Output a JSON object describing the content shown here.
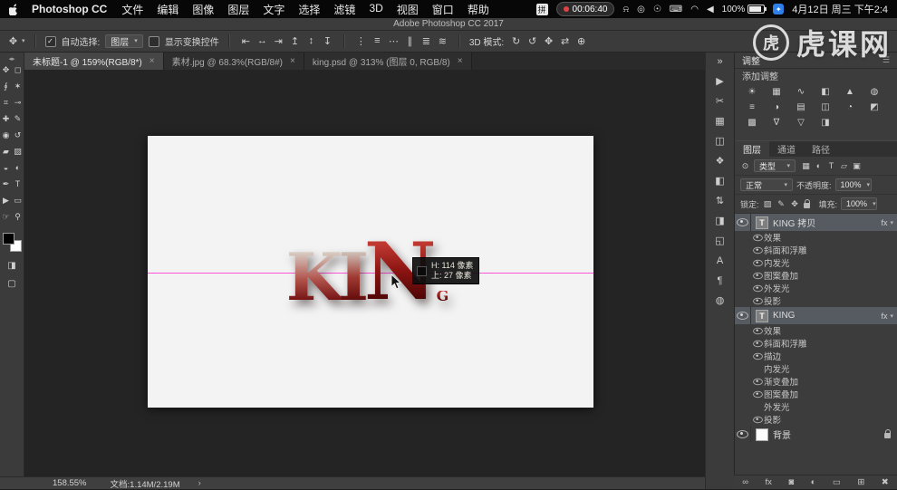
{
  "ui": {
    "caret_down": "▾",
    "check": "✓",
    "close": "×"
  },
  "menu_bar": {
    "app_name": "Photoshop CC",
    "menus": [
      "文件",
      "编辑",
      "图像",
      "图层",
      "文字",
      "选择",
      "滤镜",
      "3D",
      "视图",
      "窗口",
      "帮助"
    ],
    "input_badge": "拼",
    "timer": "00:06:40",
    "status_icons": [
      {
        "name": "bell-icon",
        "glyph": "⍾"
      },
      {
        "name": "siri-icon",
        "glyph": "◎"
      },
      {
        "name": "display-icon",
        "glyph": "☉"
      },
      {
        "name": "keyboard-icon",
        "glyph": "⌨"
      },
      {
        "name": "wifi-icon",
        "glyph": "◠"
      },
      {
        "name": "volume-icon",
        "glyph": "◀"
      }
    ],
    "battery": "100%",
    "datetime": "4月12日 周三 下午2:4"
  },
  "window_title": "Adobe Photoshop CC 2017",
  "options_bar": {
    "tool_icon": "✥",
    "auto_select_label": "自动选择:",
    "auto_select_value": "图层",
    "show_transform_label": "显示变换控件",
    "align_icons": [
      {
        "name": "align-left-edges-icon",
        "glyph": "⇤"
      },
      {
        "name": "align-horizontal-centers-icon",
        "glyph": "↔"
      },
      {
        "name": "align-right-edges-icon",
        "glyph": "⇥"
      },
      {
        "name": "align-top-edges-icon",
        "glyph": "↥"
      },
      {
        "name": "align-vertical-centers-icon",
        "glyph": "↕"
      },
      {
        "name": "align-bottom-edges-icon",
        "glyph": "↧"
      }
    ],
    "distribute_icons": [
      {
        "name": "distribute-top-icon",
        "glyph": "⋮"
      },
      {
        "name": "distribute-vertical-icon",
        "glyph": "≡"
      },
      {
        "name": "distribute-bottom-icon",
        "glyph": "⋯"
      },
      {
        "name": "distribute-left-icon",
        "glyph": "∥"
      },
      {
        "name": "distribute-horizontal-icon",
        "glyph": "≣"
      },
      {
        "name": "distribute-right-icon",
        "glyph": "≋"
      }
    ],
    "mode_3d_label": "3D 模式:",
    "mode_3d_icons": [
      {
        "name": "3d-rotate-icon",
        "glyph": "↻"
      },
      {
        "name": "3d-roll-icon",
        "glyph": "↺"
      },
      {
        "name": "3d-drag-icon",
        "glyph": "✥"
      },
      {
        "name": "3d-slide-icon",
        "glyph": "⇄"
      },
      {
        "name": "3d-scale-icon",
        "glyph": "⊕"
      }
    ]
  },
  "tabs": [
    {
      "label": "未标题-1 @ 159%(RGB/8*)",
      "active": true
    },
    {
      "label": "素材.jpg @ 68.3%(RGB/8#)",
      "active": false
    },
    {
      "label": "king.psd @ 313% (图层 0, RGB/8)",
      "active": false
    }
  ],
  "toolbar": {
    "collapse_icon": "◂▸",
    "tools": [
      {
        "name": "move-tool",
        "glyph": "✥"
      },
      {
        "name": "marquee-tool",
        "glyph": "◻"
      },
      {
        "name": "lasso-tool",
        "glyph": "∮"
      },
      {
        "name": "quick-select-tool",
        "glyph": "✶"
      },
      {
        "name": "crop-tool",
        "glyph": "⌗"
      },
      {
        "name": "eyedropper-tool",
        "glyph": "⊸"
      },
      {
        "name": "healing-brush-tool",
        "glyph": "✚"
      },
      {
        "name": "brush-tool",
        "glyph": "✎"
      },
      {
        "name": "clone-stamp-tool",
        "glyph": "◉"
      },
      {
        "name": "history-brush-tool",
        "glyph": "↺"
      },
      {
        "name": "eraser-tool",
        "glyph": "▰"
      },
      {
        "name": "gradient-tool",
        "glyph": "▨"
      },
      {
        "name": "blur-tool",
        "glyph": "◒"
      },
      {
        "name": "dodge-tool",
        "glyph": "◐"
      },
      {
        "name": "pen-tool",
        "glyph": "✒"
      },
      {
        "name": "type-tool",
        "glyph": "T"
      },
      {
        "name": "path-select-tool",
        "glyph": "▶"
      },
      {
        "name": "shape-tool",
        "glyph": "▭"
      },
      {
        "name": "hand-tool",
        "glyph": "☞"
      },
      {
        "name": "zoom-tool",
        "glyph": "⚲"
      }
    ],
    "quick_mask_icon": "◨",
    "screen_mode_icon": "▢"
  },
  "canvas": {
    "letters": [
      "K",
      "I",
      "N",
      "G"
    ],
    "tooltip": {
      "line1": "H: 114 像素",
      "line2": "上: 27 像素"
    }
  },
  "panel_strip": {
    "icons": [
      {
        "name": "collapse-panels-icon",
        "glyph": "»"
      },
      {
        "name": "libraries-panel-icon",
        "glyph": "▶"
      },
      {
        "name": "scissors-icon",
        "glyph": "✂"
      },
      {
        "name": "grid-panel-icon",
        "glyph": "▦"
      },
      {
        "name": "swatches-panel-icon",
        "glyph": "◫"
      },
      {
        "name": "styles-panel-icon",
        "glyph": "❖"
      },
      {
        "name": "adjustments-panel-icon",
        "glyph": "◧"
      },
      {
        "name": "history-panel-icon",
        "glyph": "⇅"
      },
      {
        "name": "gradients-panel-icon",
        "glyph": "◨"
      },
      {
        "name": "3d-panel-icon",
        "glyph": "◱"
      },
      {
        "name": "character-panel-icon",
        "glyph": "A"
      },
      {
        "name": "paragraph-panel-icon",
        "glyph": "¶"
      },
      {
        "name": "clone-source-panel-icon",
        "glyph": "◍"
      }
    ]
  },
  "adjustments": {
    "title": "调整",
    "menu_icon": "☰",
    "add_label": "添加调整",
    "icons": [
      {
        "name": "brightness-contrast-icon",
        "glyph": "☀"
      },
      {
        "name": "levels-icon",
        "glyph": "▦"
      },
      {
        "name": "curves-icon",
        "glyph": "∿"
      },
      {
        "name": "exposure-icon",
        "glyph": "◧"
      },
      {
        "name": "vibrance-icon",
        "glyph": "▲"
      },
      {
        "name": "hue-saturation-icon",
        "glyph": "◍"
      },
      {
        "name": "color-balance-icon",
        "glyph": "≡"
      },
      {
        "name": "black-white-icon",
        "glyph": "◑"
      },
      {
        "name": "photo-filter-icon",
        "glyph": "▤"
      },
      {
        "name": "channel-mixer-icon",
        "glyph": "◫"
      },
      {
        "name": "color-lookup-icon",
        "glyph": "◔"
      },
      {
        "name": "invert-icon",
        "glyph": "◩"
      },
      {
        "name": "posterize-icon",
        "glyph": "▩"
      },
      {
        "name": "threshold-icon",
        "glyph": "∇"
      },
      {
        "name": "gradient-map-icon",
        "glyph": "▽"
      },
      {
        "name": "selective-color-icon",
        "glyph": "◨"
      }
    ]
  },
  "layers": {
    "tabs": [
      {
        "label": "图层",
        "active": true
      },
      {
        "label": "通道",
        "active": false
      },
      {
        "label": "路径",
        "active": false
      }
    ],
    "search_icon": "⊙",
    "filter_label": "类型",
    "filter_icons": [
      {
        "name": "filter-pixel-icon",
        "glyph": "▦"
      },
      {
        "name": "filter-adjustment-icon",
        "glyph": "◐"
      },
      {
        "name": "filter-type-icon",
        "glyph": "T"
      },
      {
        "name": "filter-shape-icon",
        "glyph": "▱"
      },
      {
        "name": "filter-smart-icon",
        "glyph": "▣"
      }
    ],
    "blend_mode": "正常",
    "opacity_label": "不透明度:",
    "opacity_value": "100%",
    "lock_label": "锁定:",
    "lock_icons": [
      {
        "name": "lock-transparent-icon",
        "glyph": "▨"
      },
      {
        "name": "lock-pixels-icon",
        "glyph": "✎"
      },
      {
        "name": "lock-position-icon",
        "glyph": "✥"
      }
    ],
    "fill_label": "填充:",
    "fill_value": "100%",
    "rows": [
      {
        "label": "KING 拷贝",
        "type": "text",
        "thumb": "T",
        "badge": "fx",
        "selected": true
      },
      {
        "label": "效果",
        "type": "effect"
      },
      {
        "label": "斜面和浮雕",
        "type": "effect"
      },
      {
        "label": "内发光",
        "type": "effect"
      },
      {
        "label": "图案叠加",
        "type": "effect"
      },
      {
        "label": "外发光",
        "type": "effect"
      },
      {
        "label": "投影",
        "type": "effect"
      },
      {
        "label": "KING",
        "type": "text",
        "thumb": "T",
        "badge": "fx",
        "selected": true
      },
      {
        "label": "效果",
        "type": "effect"
      },
      {
        "label": "斜面和浮雕",
        "type": "effect"
      },
      {
        "label": "描边",
        "type": "effect"
      },
      {
        "label": "内发光",
        "type": "effect",
        "eye": false
      },
      {
        "label": "渐变叠加",
        "type": "effect"
      },
      {
        "label": "图案叠加",
        "type": "effect"
      },
      {
        "label": "外发光",
        "type": "effect",
        "eye": false
      },
      {
        "label": "投影",
        "type": "effect"
      },
      {
        "label": "背景",
        "type": "background",
        "thumb": "",
        "locked": true
      }
    ],
    "bottom_icons": [
      {
        "name": "link-layers-icon",
        "glyph": "∞"
      },
      {
        "name": "layer-style-icon",
        "glyph": "fx"
      },
      {
        "name": "layer-mask-icon",
        "glyph": "◙"
      },
      {
        "name": "adjustment-layer-icon",
        "glyph": "◐"
      },
      {
        "name": "new-group-icon",
        "glyph": "▭"
      },
      {
        "name": "new-layer-icon",
        "glyph": "⊞"
      },
      {
        "name": "delete-layer-icon",
        "glyph": "✖"
      }
    ]
  },
  "status_bar": {
    "zoom": "158.55%",
    "doc_info": "文档:1.14M/2.19M",
    "chevron": "›"
  },
  "watermark": {
    "logo_glyph": "虎",
    "text": "虎课网"
  }
}
